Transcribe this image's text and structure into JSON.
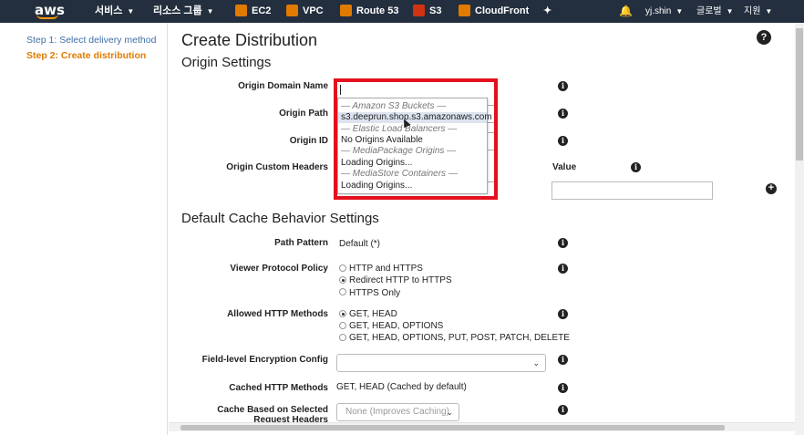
{
  "topbar": {
    "logo": "aws",
    "services": "서비스",
    "resource_groups": "리소스 그룹",
    "favorites": [
      {
        "label": "EC2",
        "icon": "ec2-icon",
        "color": "#e07b00"
      },
      {
        "label": "VPC",
        "icon": "vpc-icon",
        "color": "#e07b00"
      },
      {
        "label": "Route 53",
        "icon": "route53-icon",
        "color": "#e07b00"
      },
      {
        "label": "S3",
        "icon": "s3-icon",
        "color": "#d13212"
      },
      {
        "label": "CloudFront",
        "icon": "cloudfront-icon",
        "color": "#e07b00"
      }
    ],
    "user": "yj.shin",
    "region": "글로벌",
    "support": "지원"
  },
  "sidebar": {
    "steps": [
      {
        "label": "Step 1: Select delivery method"
      },
      {
        "label": "Step 2: Create distribution"
      }
    ]
  },
  "main": {
    "title": "Create Distribution",
    "origin_settings": {
      "heading": "Origin Settings",
      "origin_domain_name_label": "Origin Domain Name",
      "origin_domain_name_value": "",
      "origin_path_label": "Origin Path",
      "origin_id_label": "Origin ID",
      "origin_custom_headers_label": "Origin Custom Headers",
      "value_label": "Value",
      "dropdown": [
        {
          "text": "— Amazon S3 Buckets —",
          "group": true
        },
        {
          "text": "s3.deeprun.shop.s3.amazonaws.com",
          "group": false,
          "highlight": true
        },
        {
          "text": "— Elastic Load Balancers —",
          "group": true
        },
        {
          "text": "No Origins Available",
          "group": false
        },
        {
          "text": "— MediaPackage Origins —",
          "group": true
        },
        {
          "text": "Loading Origins...",
          "group": false
        },
        {
          "text": "— MediaStore Containers —",
          "group": true
        },
        {
          "text": "Loading Origins...",
          "group": false
        }
      ]
    },
    "cache_behavior": {
      "heading": "Default Cache Behavior Settings",
      "path_pattern_label": "Path Pattern",
      "path_pattern_value": "Default (*)",
      "viewer_protocol_label": "Viewer Protocol Policy",
      "viewer_protocol_options": [
        "HTTP and HTTPS",
        "Redirect HTTP to HTTPS",
        "HTTPS Only"
      ],
      "viewer_protocol_selected": 1,
      "allowed_methods_label": "Allowed HTTP Methods",
      "allowed_methods_options": [
        "GET, HEAD",
        "GET, HEAD, OPTIONS",
        "GET, HEAD, OPTIONS, PUT, POST, PATCH, DELETE"
      ],
      "allowed_methods_selected": 0,
      "fle_label": "Field-level Encryption Config",
      "fle_value": "",
      "cached_methods_label": "Cached HTTP Methods",
      "cached_methods_value": "GET, HEAD (Cached by default)",
      "cache_headers_label_1": "Cache Based on Selected",
      "cache_headers_label_2": "Request Headers",
      "cache_headers_value": "None (Improves Caching)"
    }
  }
}
